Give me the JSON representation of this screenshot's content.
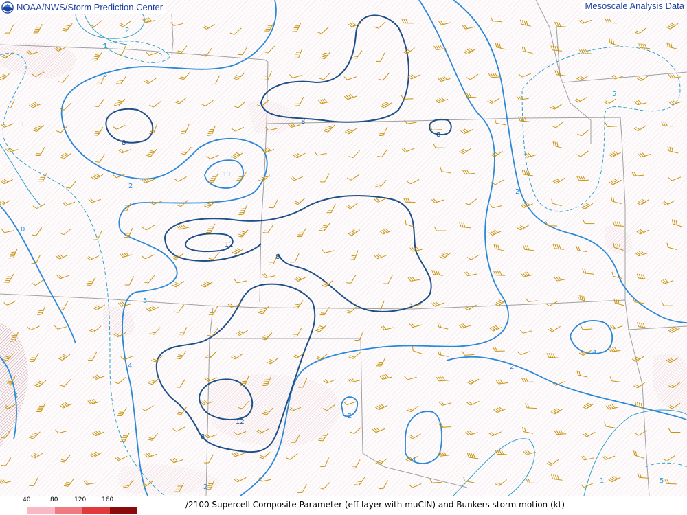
{
  "header": {
    "agency": "NOAA/NWS/Storm Prediction Center",
    "product": "Mesoscale Analysis Data",
    "logo_icon": "noaa-logo-icon"
  },
  "legend": {
    "ticks": [
      "40",
      "80",
      "120",
      "160"
    ],
    "colors": [
      "#ffffff",
      "#f8b9c4",
      "#f07a82",
      "#e23a3a",
      "#8a0a0a"
    ]
  },
  "caption": "/2100 Supercell Composite Parameter (eff layer with muCIN) and Bunkers storm motion (kt)",
  "contour_labels": {
    "l2_top": "2",
    "l1_nw": "1",
    "l5_n": "5",
    "l5_nw2": "5",
    "l1_w": "1",
    "l8_nw": "8",
    "l2_w": "2",
    "l11": "11",
    "l8_n": "8",
    "l8_ne": "8",
    "l12_c": "12",
    "l8_c": "8",
    "l5_ne": "5",
    "l2_e": "2",
    "l5_sw": "5",
    "l4_sw": "4",
    "l5_w2": "5",
    "l4_se": "4",
    "l2_se": "2",
    "l12_s": "12",
    "l8_s": "8",
    "l2_s": "2",
    "l4_s": "4",
    "l2_bl": "2",
    "l1_se": "1",
    "l5_se": "5",
    "l0_w": "0"
  },
  "colors": {
    "contour_dark": "#1e4f86",
    "contour_mid": "#2a88d8",
    "contour_light": "#2ea0c8",
    "boundary": "#a0a0a0",
    "wind_barb": "#c89410",
    "hatch": "#d9a3b3",
    "header_text": "#1f3fa0"
  }
}
